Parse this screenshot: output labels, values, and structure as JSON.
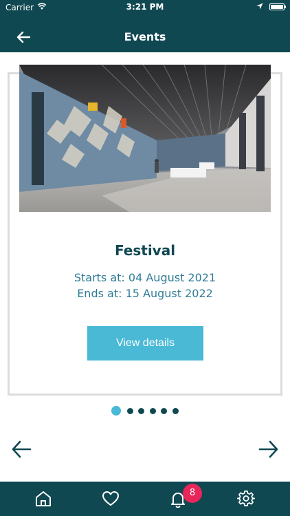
{
  "status_bar": {
    "carrier": "Carrier",
    "time": "3:21 PM"
  },
  "header": {
    "title": "Events",
    "background_color": "#104852"
  },
  "event_card": {
    "title": "Festival",
    "starts": "Starts at: 04 August 2021",
    "ends": "Ends at: 15 August 2022",
    "button_label": "View details",
    "button_color": "#4ab9d6"
  },
  "pagination": {
    "total": 6,
    "active_index": 0
  },
  "tabbar": {
    "items": [
      {
        "icon": "home-icon"
      },
      {
        "icon": "heart-icon"
      },
      {
        "icon": "bell-icon"
      },
      {
        "icon": "gear-icon"
      }
    ],
    "notification_count": "8",
    "badge_color": "#e8265a"
  }
}
